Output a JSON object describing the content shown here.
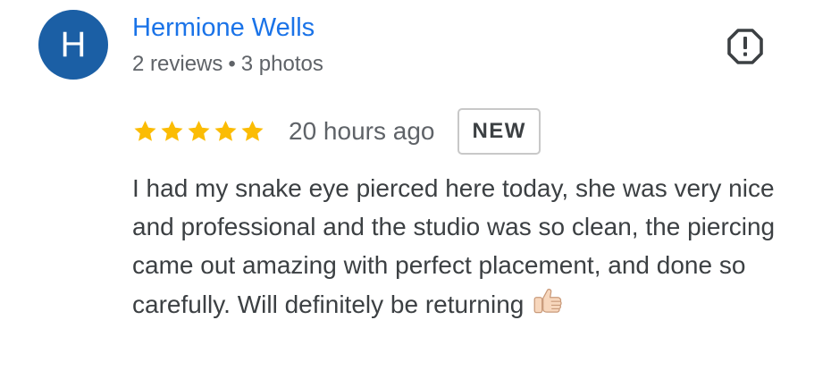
{
  "reviewer": {
    "avatar_initial": "H",
    "name": "Hermione Wells",
    "reviews_count": "2 reviews",
    "separator": "•",
    "photos_count": "3 photos",
    "avatar_color": "#1b5fa5",
    "name_color": "#1a73e8"
  },
  "report_button": {
    "icon": "report-octagon-icon"
  },
  "rating": {
    "stars": 5,
    "max_stars": 5,
    "star_color": "#fbbc04",
    "time_ago": "20 hours ago",
    "badge": "NEW"
  },
  "review": {
    "text": "I had my snake eye pierced here today, she was very nice and professional and the studio was so clean, the piercing came out amazing with perfect placement, and done so carefully. Will definitely be returning",
    "emoji": "thumbs-up-icon"
  }
}
